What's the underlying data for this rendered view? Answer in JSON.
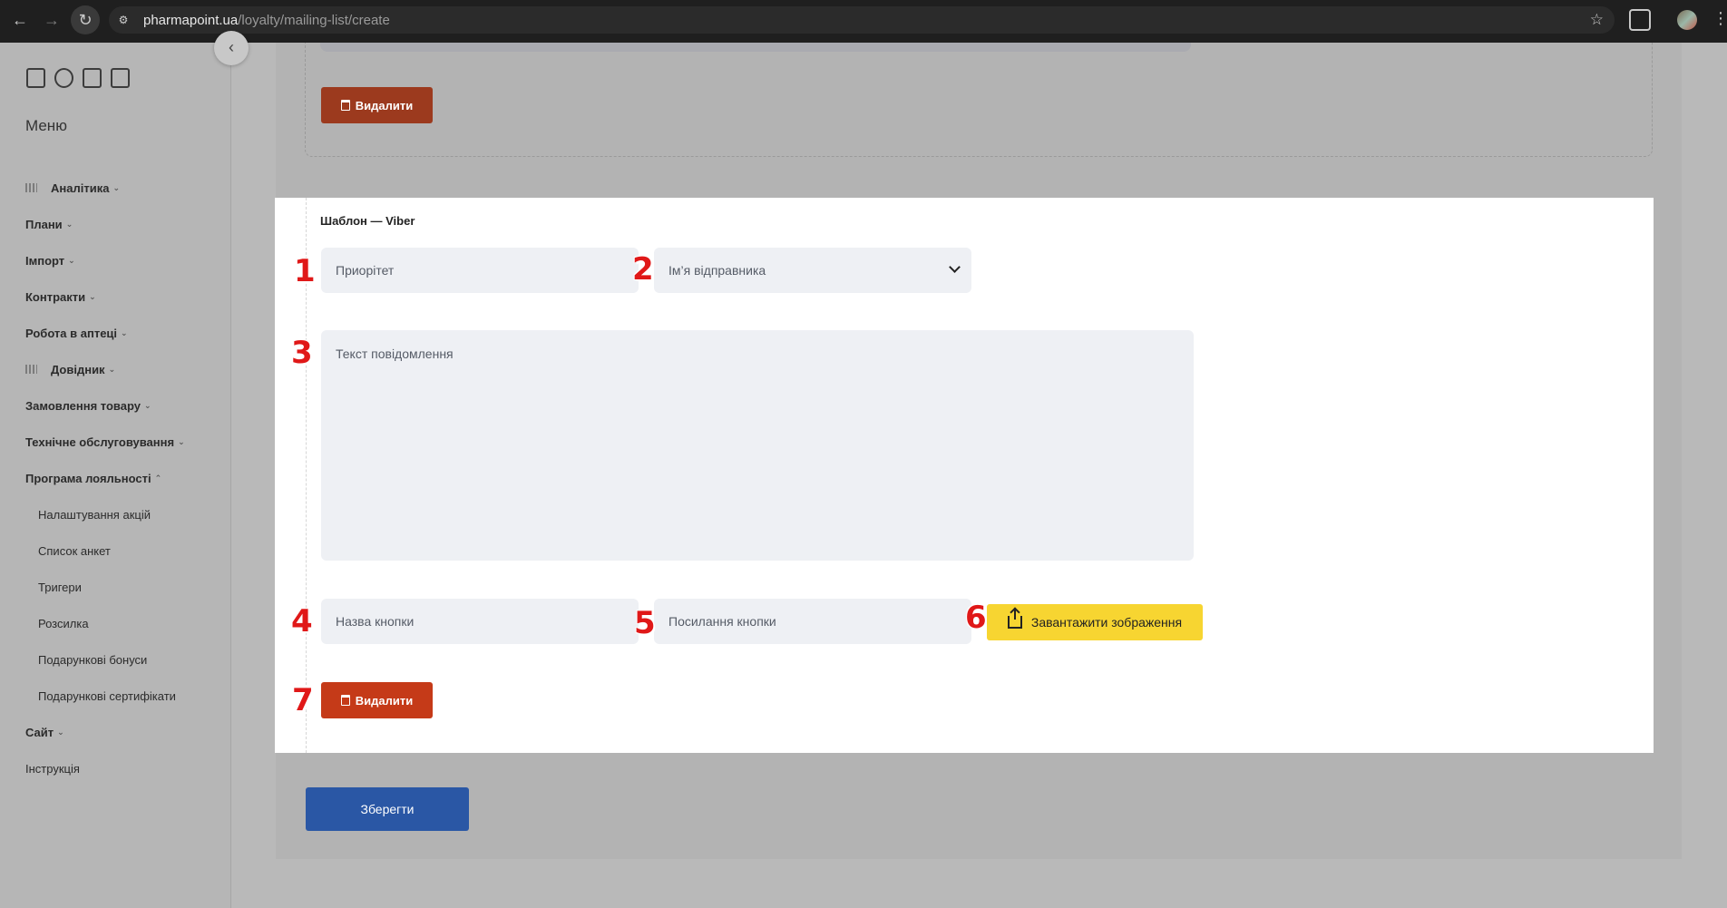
{
  "browser": {
    "url_host": "pharmapoint.ua",
    "url_path": "/loyalty/mailing-list/create"
  },
  "sidebar": {
    "title": "Меню",
    "items": [
      {
        "label": "Аналітика",
        "icon": "grid-icon"
      },
      {
        "label": "Плани"
      },
      {
        "label": "Імпорт"
      },
      {
        "label": "Контракти"
      },
      {
        "label": "Робота в аптеці"
      },
      {
        "label": "Довідник",
        "icon": "grid-icon"
      },
      {
        "label": "Замовлення товару"
      },
      {
        "label": "Технічне обслуговування"
      },
      {
        "label": "Програма лояльності",
        "expanded": true
      },
      {
        "label": "Налаштування акцій"
      },
      {
        "label": "Список анкет"
      },
      {
        "label": "Тригери"
      },
      {
        "label": "Розсилка"
      },
      {
        "label": "Подарункові бонуси"
      },
      {
        "label": "Подарункові сертифікати"
      },
      {
        "label": "Сайт"
      },
      {
        "label": "Інструкція"
      }
    ]
  },
  "upper_card": {
    "delete_label": "Видалити"
  },
  "viber_card": {
    "title": "Шаблон — Viber",
    "priority_placeholder": "Приорітет",
    "sender_placeholder": "Ім’я відправника",
    "message_placeholder": "Текст повідомлення",
    "button_name_placeholder": "Назва кнопки",
    "button_link_placeholder": "Посилання кнопки",
    "upload_label": "Завантажити зображення",
    "delete_label": "Видалити"
  },
  "annotations": [
    "1",
    "2",
    "3",
    "4",
    "5",
    "6",
    "7"
  ],
  "save_label": "Зберегти",
  "colors": {
    "delete": "#c53a18",
    "upload": "#f7d531",
    "save": "#2a57a5",
    "annotation": "#e01818"
  }
}
